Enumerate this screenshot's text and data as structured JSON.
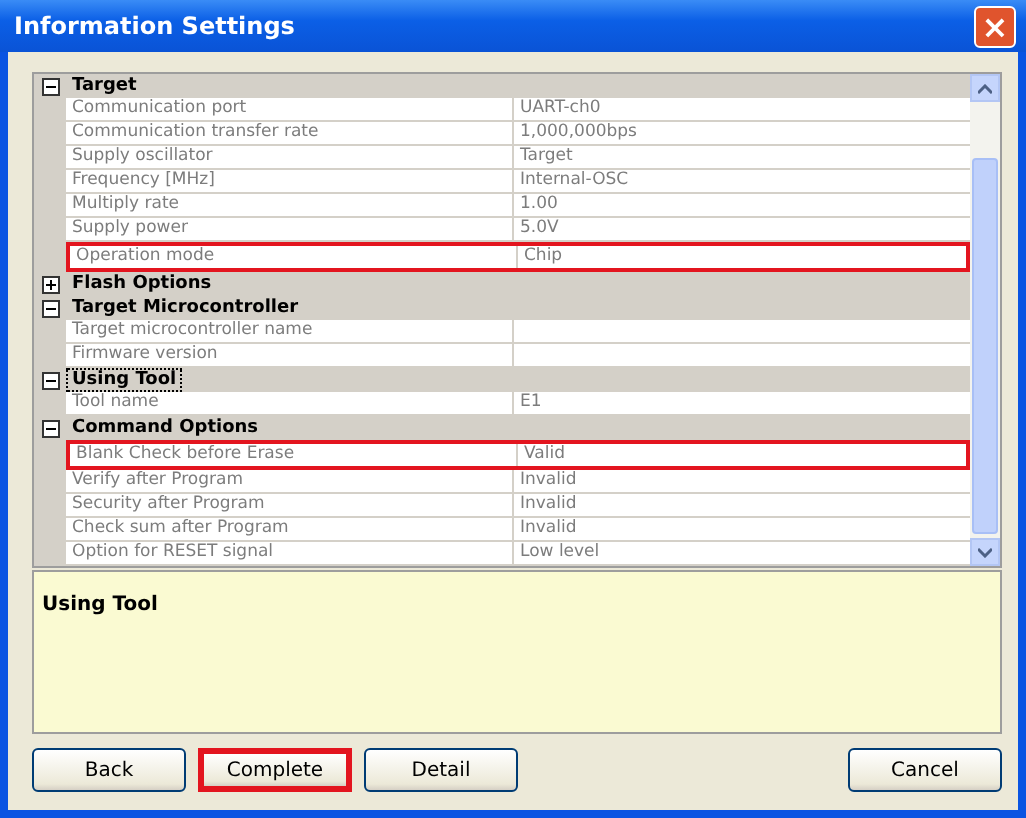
{
  "window": {
    "title": "Information Settings",
    "close": "×"
  },
  "groups": [
    {
      "label": "Target",
      "expanded": true,
      "selected": false,
      "rows": [
        {
          "name": "Communication port",
          "value": "UART-ch0",
          "highlighted": false
        },
        {
          "name": "Communication transfer rate",
          "value": "1,000,000bps",
          "highlighted": false
        },
        {
          "name": "Supply oscillator",
          "value": "Target",
          "highlighted": false
        },
        {
          "name": "Frequency [MHz]",
          "value": "Internal-OSC",
          "highlighted": false
        },
        {
          "name": "Multiply rate",
          "value": "1.00",
          "highlighted": false
        },
        {
          "name": "Supply power",
          "value": "5.0V",
          "highlighted": false
        },
        {
          "name": "Operation mode",
          "value": "Chip",
          "highlighted": true
        }
      ]
    },
    {
      "label": "Flash Options",
      "expanded": false,
      "selected": false
    },
    {
      "label": "Target Microcontroller",
      "expanded": true,
      "selected": false,
      "rows": [
        {
          "name": "Target microcontroller name",
          "highlighted": false
        },
        {
          "name": "Firmware version",
          "highlighted": false
        }
      ]
    },
    {
      "label": "Using Tool",
      "expanded": true,
      "selected": true,
      "rows": [
        {
          "name": "Tool name",
          "value": "E1",
          "highlighted": false
        }
      ]
    },
    {
      "label": "Command Options",
      "expanded": true,
      "selected": false,
      "rows": [
        {
          "name": "Blank Check before Erase",
          "value": "Valid",
          "highlighted": true
        },
        {
          "name": "Verify after Program",
          "value": "Invalid",
          "highlighted": false
        },
        {
          "name": "Security after Program",
          "value": "Invalid",
          "highlighted": false
        },
        {
          "name": "Check sum after Program",
          "value": "Invalid",
          "highlighted": false
        },
        {
          "name": "Option for RESET signal",
          "value": "Low level",
          "highlighted": false
        }
      ]
    }
  ],
  "description": "Using Tool",
  "left_buttons": [
    {
      "label": "Back",
      "highlighted": false
    },
    {
      "label": "Complete",
      "highlighted": true
    },
    {
      "label": "Detail",
      "highlighted": false
    }
  ],
  "right_buttons": [
    {
      "label": "Cancel",
      "highlighted": false
    }
  ]
}
